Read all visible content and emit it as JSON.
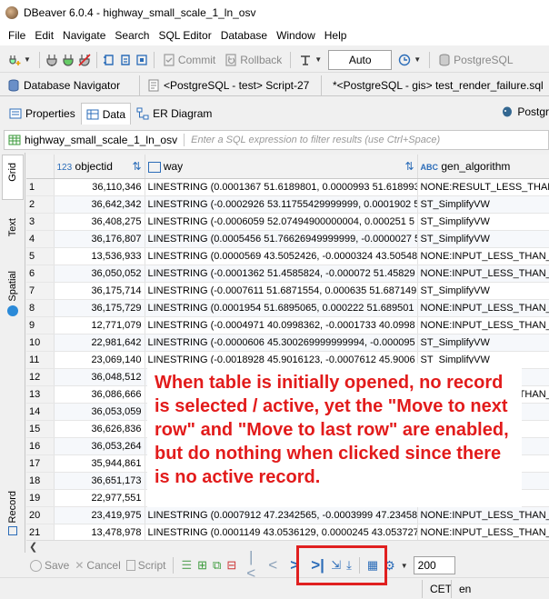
{
  "window": {
    "title": "DBeaver 6.0.4 - highway_small_scale_1_ln_osv"
  },
  "menu": [
    "File",
    "Edit",
    "Navigate",
    "Search",
    "SQL Editor",
    "Database",
    "Window",
    "Help"
  ],
  "toolbar": {
    "commit": "Commit",
    "rollback": "Rollback",
    "mode": "Auto",
    "connection": "PostgreSQL"
  },
  "editor_tabs": [
    {
      "label": "Database Navigator"
    },
    {
      "label": "<PostgreSQL - test> Script-27"
    },
    {
      "label": "*<PostgreSQL - gis> test_render_failure.sql"
    }
  ],
  "sub_tabs": {
    "properties": "Properties",
    "data": "Data",
    "er": "ER Diagram",
    "right": "Postgr"
  },
  "filter": {
    "table_name": "highway_small_scale_1_ln_osv",
    "placeholder": "Enter a SQL expression to filter results (use Ctrl+Space)"
  },
  "side_tabs": {
    "grid": "Grid",
    "text": "Text",
    "spatial": "Spatial",
    "record": "Record"
  },
  "columns": {
    "objectid": "objectid",
    "way": "way",
    "gen_algorithm": "gen_algorithm",
    "objectid_type": "123"
  },
  "rows": [
    {
      "n": "1",
      "id": "36,110,346",
      "way": "LINESTRING (0.0001367 51.6189801, 0.0000993 51.6189934",
      "gen": "NONE:RESULT_LESS_THAN_"
    },
    {
      "n": "2",
      "id": "36,642,342",
      "way": "LINESTRING (-0.0002926 53.11755429999999, 0.0001902 5",
      "gen": "ST_SimplifyVW"
    },
    {
      "n": "3",
      "id": "36,408,275",
      "way": "LINESTRING (-0.0006059 52.07494900000004, 0.000251 5",
      "gen": "ST_SimplifyVW"
    },
    {
      "n": "4",
      "id": "36,176,807",
      "way": "LINESTRING (0.0005456 51.76626949999999, -0.0000027 5",
      "gen": "ST_SimplifyVW"
    },
    {
      "n": "5",
      "id": "13,536,933",
      "way": "LINESTRING (0.0000569 43.5052426, -0.0000324 43.50548",
      "gen": "NONE:INPUT_LESS_THAN_"
    },
    {
      "n": "6",
      "id": "36,050,052",
      "way": "LINESTRING (-0.0001362 51.4585824, -0.000072 51.45829",
      "gen": "NONE:INPUT_LESS_THAN_"
    },
    {
      "n": "7",
      "id": "36,175,714",
      "way": "LINESTRING (-0.0007611 51.6871554, 0.000635 51.687149",
      "gen": "ST_SimplifyVW"
    },
    {
      "n": "8",
      "id": "36,175,729",
      "way": "LINESTRING (0.0001954 51.6895065, 0.000222 51.689501",
      "gen": "NONE:INPUT_LESS_THAN_"
    },
    {
      "n": "9",
      "id": "12,771,079",
      "way": "LINESTRING (-0.0004971 40.0998362, -0.0001733 40.0998",
      "gen": "NONE:INPUT_LESS_THAN_"
    },
    {
      "n": "10",
      "id": "22,981,642",
      "way": "LINESTRING (-0.0000606 45.300269999999994, -0.000095",
      "gen": "ST_SimplifyVW"
    },
    {
      "n": "11",
      "id": "23,069,140",
      "way": "LINESTRING (-0.0018928 45.9016123, -0.0007612 45.9006",
      "gen": "ST_SimplifyVW"
    },
    {
      "n": "12",
      "id": "36,048,512",
      "way": "L",
      "gen": ""
    },
    {
      "n": "13",
      "id": "36,086,666",
      "way": "L",
      "gen": "NONE:INPUT_LESS_THAN_"
    },
    {
      "n": "14",
      "id": "36,053,059",
      "way": "L",
      "gen": ""
    },
    {
      "n": "15",
      "id": "36,626,836",
      "way": "L",
      "gen": ""
    },
    {
      "n": "16",
      "id": "36,053,264",
      "way": "L",
      "gen": ""
    },
    {
      "n": "17",
      "id": "35,944,861",
      "way": "L",
      "gen": ""
    },
    {
      "n": "18",
      "id": "36,651,173",
      "way": "L",
      "gen": ""
    },
    {
      "n": "19",
      "id": "22,977,551",
      "way": "L",
      "gen": ""
    },
    {
      "n": "20",
      "id": "23,419,975",
      "way": "LINESTRING (0.0007912 47.2342565, -0.0003999 47.23458",
      "gen": "NONE:INPUT_LESS_THAN_"
    },
    {
      "n": "21",
      "id": "13,478,978",
      "way": "LINESTRING (0.0001149 43.0536129, 0.0000245 43.053727",
      "gen": "NONE:INPUT_LESS_THAN_"
    }
  ],
  "bottom": {
    "save": "Save",
    "cancel": "Cancel",
    "script": "Script",
    "fetch_size": "200"
  },
  "status": {
    "timezone": "CET",
    "locale": "en"
  },
  "annotation": "When table is initially opened, no record is selected / active, yet the \"Move to next row\" and \"Move to last row\" are enabled, but do nothing when clicked since there is no active record.",
  "colors": {
    "annotation_red": "#e21b1b",
    "nav_blue": "#2b6cb8"
  }
}
